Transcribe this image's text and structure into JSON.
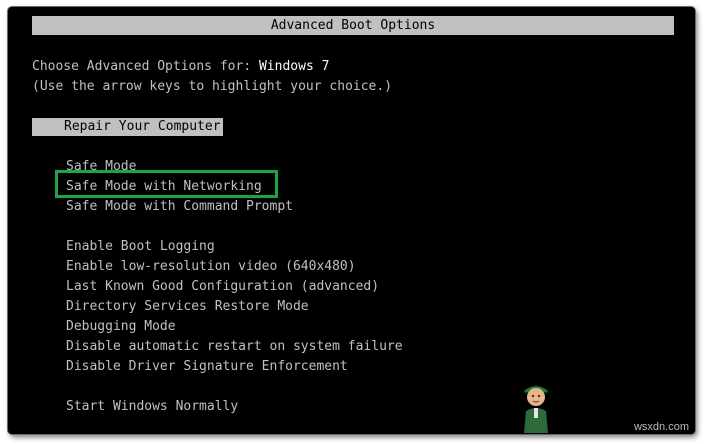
{
  "header": {
    "title": "Advanced Boot Options"
  },
  "prompt": {
    "choose_label": "Choose Advanced Options for: ",
    "os_name": "Windows 7",
    "hint": "(Use the arrow keys to highlight your choice.)"
  },
  "menu": {
    "selected_item": "Repair Your Computer",
    "safe_modes": [
      "Safe Mode",
      "Safe Mode with Networking",
      "Safe Mode with Command Prompt"
    ],
    "advanced": [
      "Enable Boot Logging",
      "Enable low-resolution video (640x480)",
      "Last Known Good Configuration (advanced)",
      "Directory Services Restore Mode",
      "Debugging Mode",
      "Disable automatic restart on system failure",
      "Disable Driver Signature Enforcement"
    ],
    "normal": "Start Windows Normally"
  },
  "annotation": {
    "highlighted_item": "Safe Mode with Networking",
    "color": "#1fa34a"
  },
  "watermark": {
    "text": "wsxdn.com"
  },
  "colors": {
    "background": "#000000",
    "text": "#c0c0c0",
    "bright_text": "#ffffff",
    "selection_bar": "#c0c0c0"
  }
}
